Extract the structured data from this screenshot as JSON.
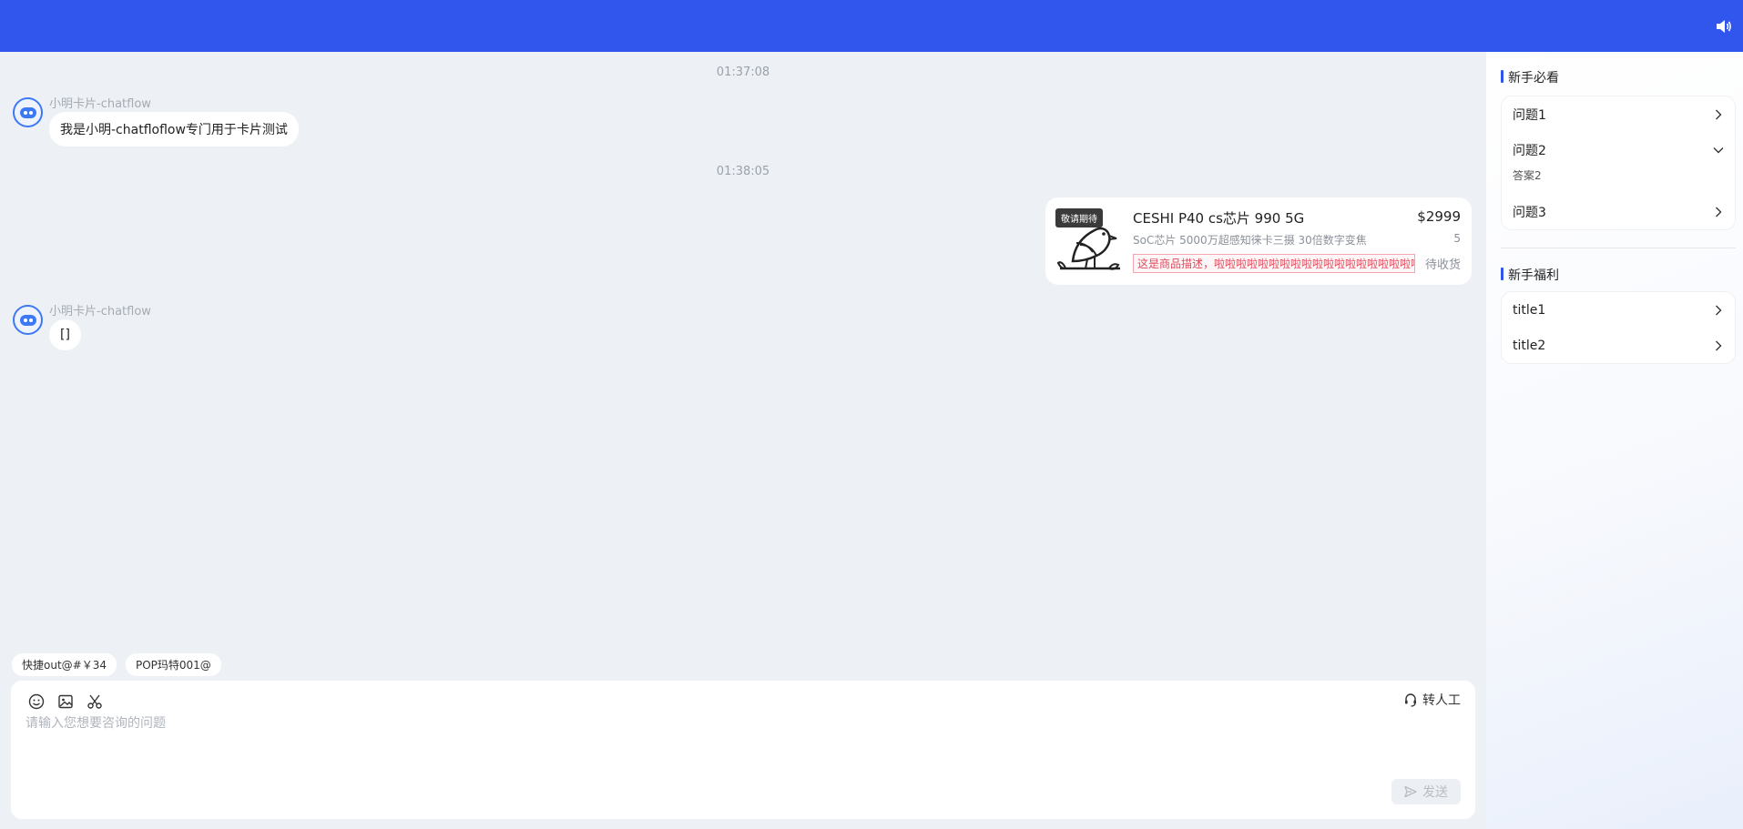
{
  "header": {
    "sound_icon": "speaker-icon",
    "bg_color": "#3056ed"
  },
  "chat": {
    "timestamp_1": "01:37:08",
    "message_1": {
      "sender": "小明卡片-chatflow",
      "text": "我是小明-chatfloflow专门用于卡片测试"
    },
    "timestamp_2": "01:38:05",
    "product": {
      "tag": "敬请期待",
      "title": "CESHI P40 cs芯片 990 5G",
      "price": "$2999",
      "subtitle": "SoC芯片 5000万超感知徕卡三摄 30倍数字变焦",
      "quantity": "5",
      "description": "这是商品描述，啦啦啦啦啦啦啦啦啦啦啦啦啦啦啦啦啦啦啦",
      "status": "待收货"
    },
    "message_2": {
      "sender": "小明卡片-chatflow",
      "text": "[]"
    }
  },
  "quick_replies": [
    "快捷out@#￥34",
    "POP玛特001@"
  ],
  "composer": {
    "tools": [
      "emoji-icon",
      "image-icon",
      "scissors-icon"
    ],
    "transfer_label": "转人工",
    "placeholder": "请输入您想要咨询的问题",
    "send_label": "发送"
  },
  "sidebar": {
    "guide_title": "新手必看",
    "faq": [
      {
        "question": "问题1",
        "expanded": false
      },
      {
        "question": "问题2",
        "expanded": true,
        "answer": "答案2"
      },
      {
        "question": "问题3",
        "expanded": false
      }
    ],
    "benefit_title": "新手福利",
    "benefits": [
      {
        "title": "title1"
      },
      {
        "title": "title2"
      }
    ]
  },
  "colors": {
    "accent": "#3056ed",
    "background": "#edf1f5",
    "desc_red": "#e04b5c"
  }
}
